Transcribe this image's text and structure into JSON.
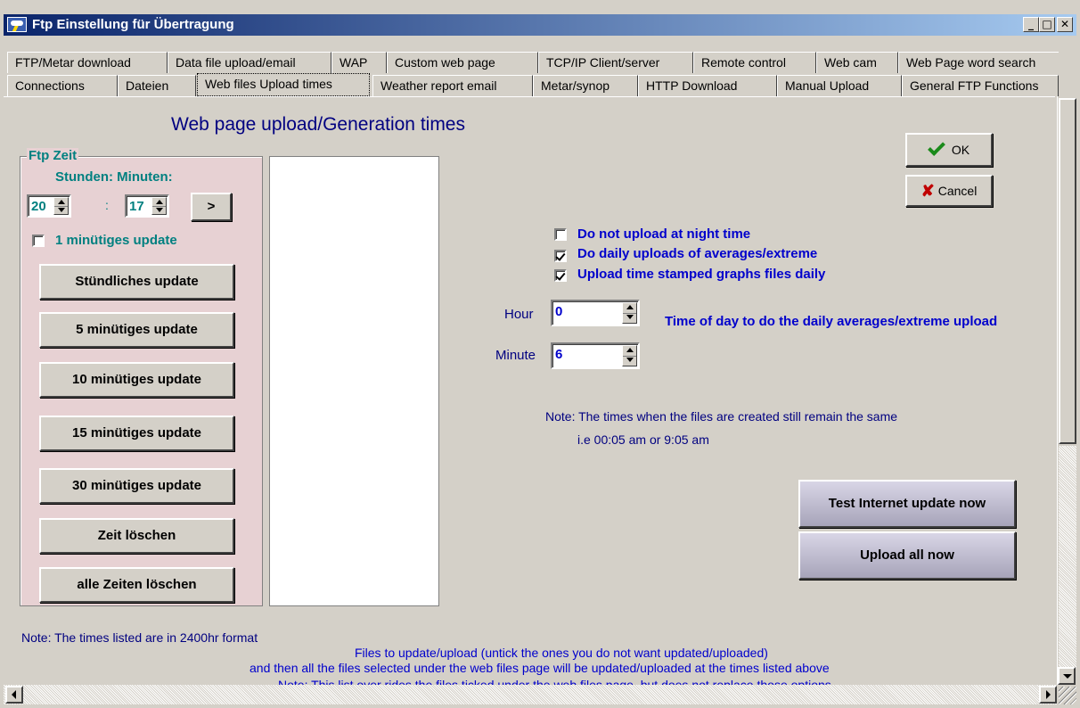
{
  "window": {
    "title": "Ftp Einstellung für Übertragung",
    "controls": {
      "minimize": "_",
      "maximize": "□",
      "close": "✕"
    }
  },
  "tabs_row1": [
    {
      "label": "FTP/Metar download"
    },
    {
      "label": "Data file upload/email"
    },
    {
      "label": "WAP"
    },
    {
      "label": "Custom web page"
    },
    {
      "label": "TCP/IP Client/server"
    },
    {
      "label": "Remote control"
    },
    {
      "label": "Web cam"
    },
    {
      "label": "Web Page word search"
    }
  ],
  "tabs_row2": [
    {
      "label": "Connections"
    },
    {
      "label": "Dateien"
    },
    {
      "label": "Web files Upload times",
      "active": true
    },
    {
      "label": "Weather report email"
    },
    {
      "label": "Metar/synop"
    },
    {
      "label": "HTTP Download"
    },
    {
      "label": "Manual Upload"
    },
    {
      "label": "General FTP Functions"
    }
  ],
  "page": {
    "title": "Web page upload/Generation times"
  },
  "ftp_panel": {
    "legend": "Ftp Zeit",
    "hm_label": "Stunden: Minuten:",
    "hour_value": "20",
    "minute_value": "17",
    "colon": ":",
    "arrow_label": ">",
    "one_minute_label": "1 minütiges update",
    "one_minute_checked": false,
    "buttons": {
      "hourly": "Stündliches update",
      "five": "5 minütiges update",
      "ten": "10 minütiges update",
      "fifteen": "15 minütiges update",
      "thirty": "30 minütiges update",
      "clear": "Zeit löschen",
      "clear_all": "alle Zeiten löschen"
    }
  },
  "dialog_buttons": {
    "ok": "OK",
    "cancel": "Cancel"
  },
  "options": {
    "night": {
      "label": "Do not upload at night time",
      "checked": false
    },
    "daily": {
      "label": "Do daily uploads of averages/extreme",
      "checked": true
    },
    "graphs": {
      "label": "Upload time stamped graphs files daily",
      "checked": true
    }
  },
  "daily_time": {
    "hour_label": "Hour",
    "hour_value": "0",
    "minute_label": "Minute",
    "minute_value": "6",
    "description": "Time of day to do the daily averages/extreme upload"
  },
  "notes": {
    "times_created": "Note: The times when the files are created still remain the same",
    "times_example": "i.e 00:05 am or 9:05 am",
    "format": "Note: The times listed are in 2400hr format",
    "files_line1": "Files to update/upload (untick the ones you do not want updated/uploaded)",
    "files_line2": "and then all the files selected under the web files page will be updated/uploaded at the times listed above",
    "files_line3": "Note: This list over rides the files ticked under the web files page, but does not replace those options"
  },
  "action_buttons": {
    "test": "Test Internet update now",
    "upload": "Upload all now"
  },
  "colors": {
    "title_gradient_start": "#0a246a",
    "panel_bg": "#e7d1d3",
    "label_teal": "#008080",
    "label_blue": "#0000cc"
  }
}
